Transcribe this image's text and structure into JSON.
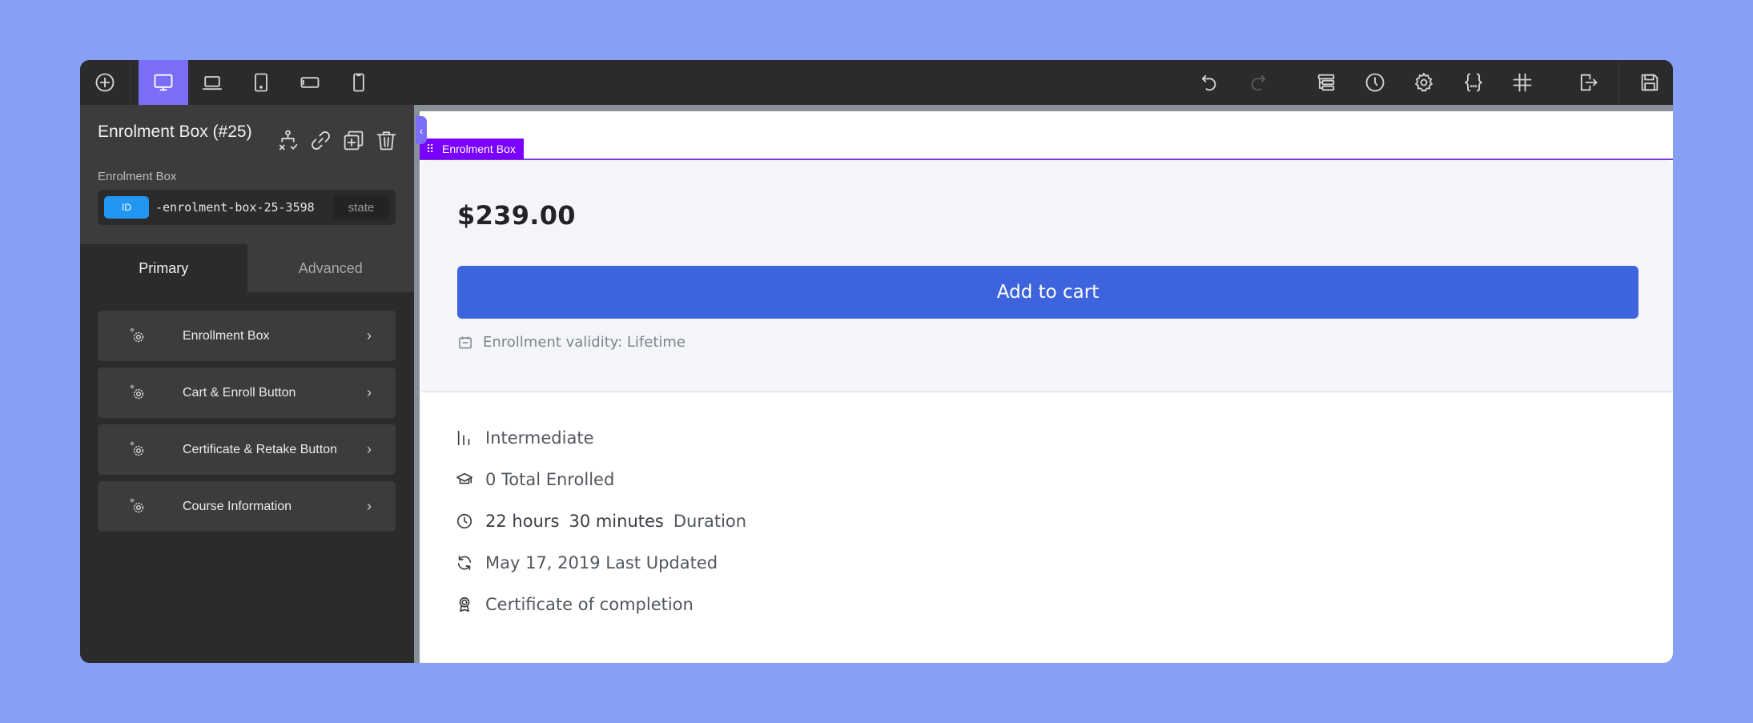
{
  "toolbar": {
    "left_icons": [
      {
        "name": "add-element-icon",
        "label": "Add"
      },
      {
        "name": "desktop-icon",
        "label": "Desktop",
        "active": true
      },
      {
        "name": "laptop-icon",
        "label": "Laptop"
      },
      {
        "name": "tablet-portrait-icon",
        "label": "Tablet portrait"
      },
      {
        "name": "mobile-landscape-icon",
        "label": "Mobile landscape"
      },
      {
        "name": "mobile-portrait-icon",
        "label": "Mobile portrait"
      }
    ],
    "right_icons": [
      {
        "name": "undo-icon",
        "label": "Undo"
      },
      {
        "name": "redo-icon",
        "label": "Redo",
        "disabled": true
      },
      {
        "name": "structure-icon",
        "label": "Structure"
      },
      {
        "name": "history-icon",
        "label": "History"
      },
      {
        "name": "settings-icon",
        "label": "Settings"
      },
      {
        "name": "code-icon",
        "label": "Code"
      },
      {
        "name": "grid-icon",
        "label": "Grid"
      },
      {
        "name": "exit-icon",
        "label": "Exit"
      },
      {
        "name": "save-icon",
        "label": "Save"
      }
    ]
  },
  "panel": {
    "element_title": "Enrolment Box (#25)",
    "element_type": "Enrolment Box",
    "id_badge": "ID",
    "id_value": "-enrolment-box-25-3598",
    "state_label": "state",
    "tabs": [
      {
        "label": "Primary",
        "active": true
      },
      {
        "label": "Advanced",
        "active": false
      }
    ],
    "groups": [
      {
        "label": "Enrollment Box"
      },
      {
        "label": "Cart & Enroll Button"
      },
      {
        "label": "Certificate & Retake Button"
      },
      {
        "label": "Course Information"
      }
    ],
    "collapse_glyph": "‹"
  },
  "canvas": {
    "selected_label": "Enrolment Box",
    "price": "$239.00",
    "cart_button": "Add to cart",
    "validity": "Enrollment validity: Lifetime",
    "info": {
      "level": "Intermediate",
      "enrolled": "0 Total Enrolled",
      "duration_hours": "22 hours",
      "duration_minutes": "30 minutes",
      "duration_label": "Duration",
      "updated": "May 17, 2019 Last Updated",
      "certificate": "Certificate of completion"
    }
  },
  "colors": {
    "accent": "#7b6ef6",
    "selection": "#7a00ff",
    "button": "#3d64dc",
    "id_badge": "#2196f3",
    "background": "#87a0f6"
  }
}
